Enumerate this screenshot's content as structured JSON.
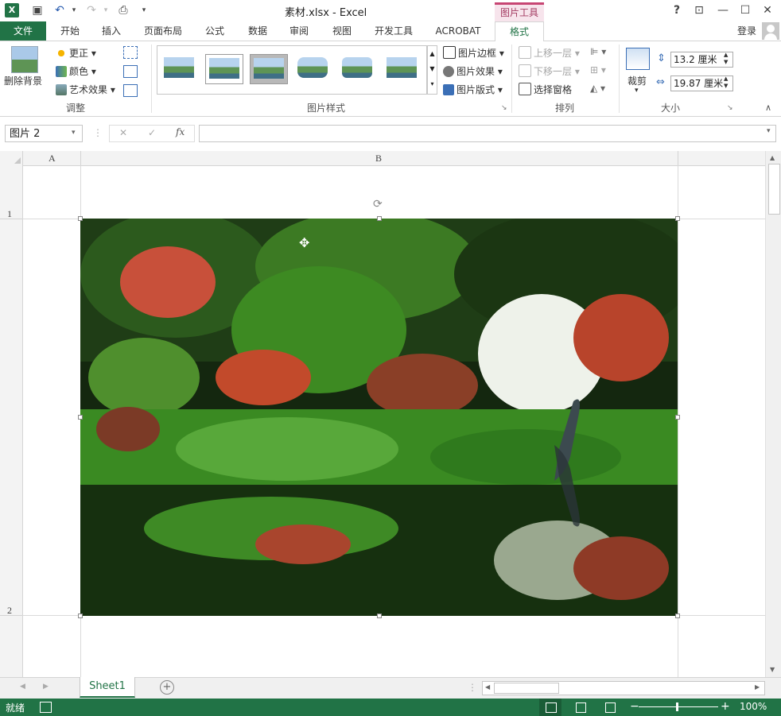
{
  "titlebar": {
    "title": "素材.xlsx - Excel",
    "help": "?",
    "restore_ribbon": "⊡",
    "minimize": "—",
    "maximize": "☐",
    "close": "✕",
    "app_icon": "excel-icon"
  },
  "contextual": {
    "label": "图片工具",
    "color": "#c74573"
  },
  "tabs": [
    {
      "label": "文件"
    },
    {
      "label": "开始"
    },
    {
      "label": "插入"
    },
    {
      "label": "页面布局"
    },
    {
      "label": "公式"
    },
    {
      "label": "数据"
    },
    {
      "label": "审阅"
    },
    {
      "label": "视图"
    },
    {
      "label": "开发工具"
    },
    {
      "label": "ACROBAT"
    },
    {
      "label": "格式"
    }
  ],
  "account": {
    "signin": "登录"
  },
  "ribbon": {
    "adjust": {
      "remove_bg": "删除背景",
      "corrections": "更正",
      "color": "颜色",
      "artistic": "艺术效果",
      "group_label": "调整"
    },
    "styles": {
      "border": "图片边框",
      "effects": "图片效果",
      "layout": "图片版式",
      "group_label": "图片样式"
    },
    "arrange": {
      "bring_forward": "上移一层",
      "send_backward": "下移一层",
      "selection_pane": "选择窗格",
      "group_label": "排列"
    },
    "size": {
      "crop": "裁剪",
      "height": "13.2 厘米",
      "width": "19.87 厘米",
      "group_label": "大小"
    }
  },
  "formula_bar": {
    "name_box": "图片 2",
    "cancel": "✕",
    "enter": "✓",
    "fx": "fx",
    "value": ""
  },
  "grid": {
    "columns": [
      "A",
      "B"
    ],
    "rows": [
      "1",
      "2"
    ]
  },
  "sheets": {
    "active": "Sheet1",
    "add": "+"
  },
  "status": {
    "ready": "就绪",
    "zoom": "100%"
  },
  "colors": {
    "accent": "#217346",
    "contextual": "#c74573"
  }
}
